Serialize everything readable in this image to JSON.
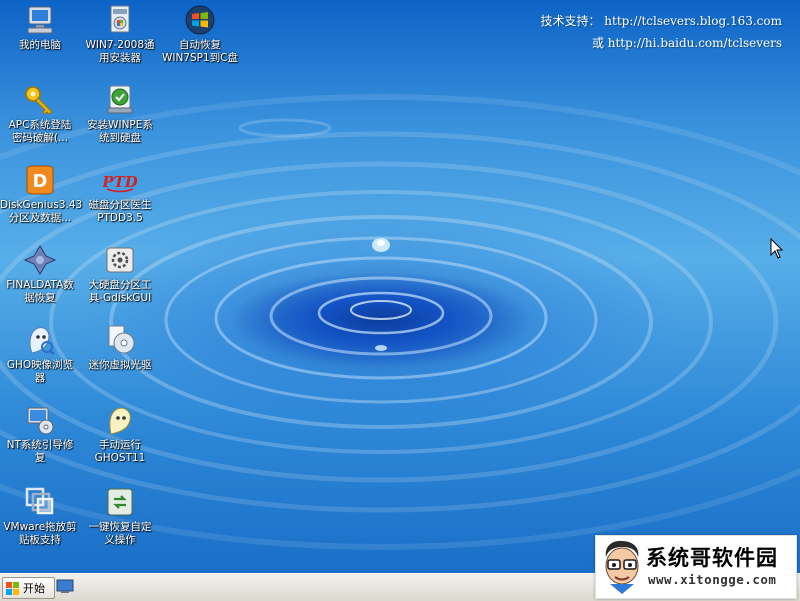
{
  "info": {
    "line1": "技术支持：  http://tclsevers.blog.163.com",
    "line2": "或   http://hi.baidu.com/tclsevers"
  },
  "icons": [
    {
      "label": "我的电脑",
      "icon": "computer-icon"
    },
    {
      "label": "WIN7-2008通\n用安装器",
      "icon": "installer-icon"
    },
    {
      "label": "自动恢复\nWIN7SP1到C盘",
      "icon": "windows-logo-icon"
    },
    {
      "label": "APC系统登陆\n密码破解(...",
      "icon": "key-icon"
    },
    {
      "label": "安装WINPE系\n统到硬盘",
      "icon": "install-winpe-icon"
    },
    {
      "label": "DiskGenius3.43\n分区及数据...",
      "icon": "diskgenius-icon"
    },
    {
      "label": "磁盘分区医生\nPTDD3.5",
      "icon": "ptdd-icon"
    },
    {
      "label": "FINALDATA数\n据恢复",
      "icon": "finaldata-icon"
    },
    {
      "label": "大硬盘分区工\n具-GdiskGUI",
      "icon": "gdisk-icon"
    },
    {
      "label": "GHO映像浏览\n器",
      "icon": "ghost-explorer-icon"
    },
    {
      "label": "迷你虚拟光驱",
      "icon": "virtual-cdrom-icon"
    },
    {
      "label": "NT系统引导修\n复",
      "icon": "nt-boot-repair-icon"
    },
    {
      "label": "手动运行\nGHOST11",
      "icon": "ghost-icon"
    },
    {
      "label": "VMware拖放剪\n贴板支持",
      "icon": "vmware-icon"
    },
    {
      "label": "一键恢复自定\n义操作",
      "icon": "one-key-restore-icon"
    }
  ],
  "taskbar": {
    "start_label": "开始",
    "quick_launch_icon": "show-desktop-icon"
  },
  "watermark": {
    "title": "系统哥软件园",
    "url": "www.xitongge.com"
  },
  "colors": {
    "desktop_blue": "#3a92dd",
    "taskbar": "#e6e3dc",
    "label_text": "#ffffff"
  }
}
